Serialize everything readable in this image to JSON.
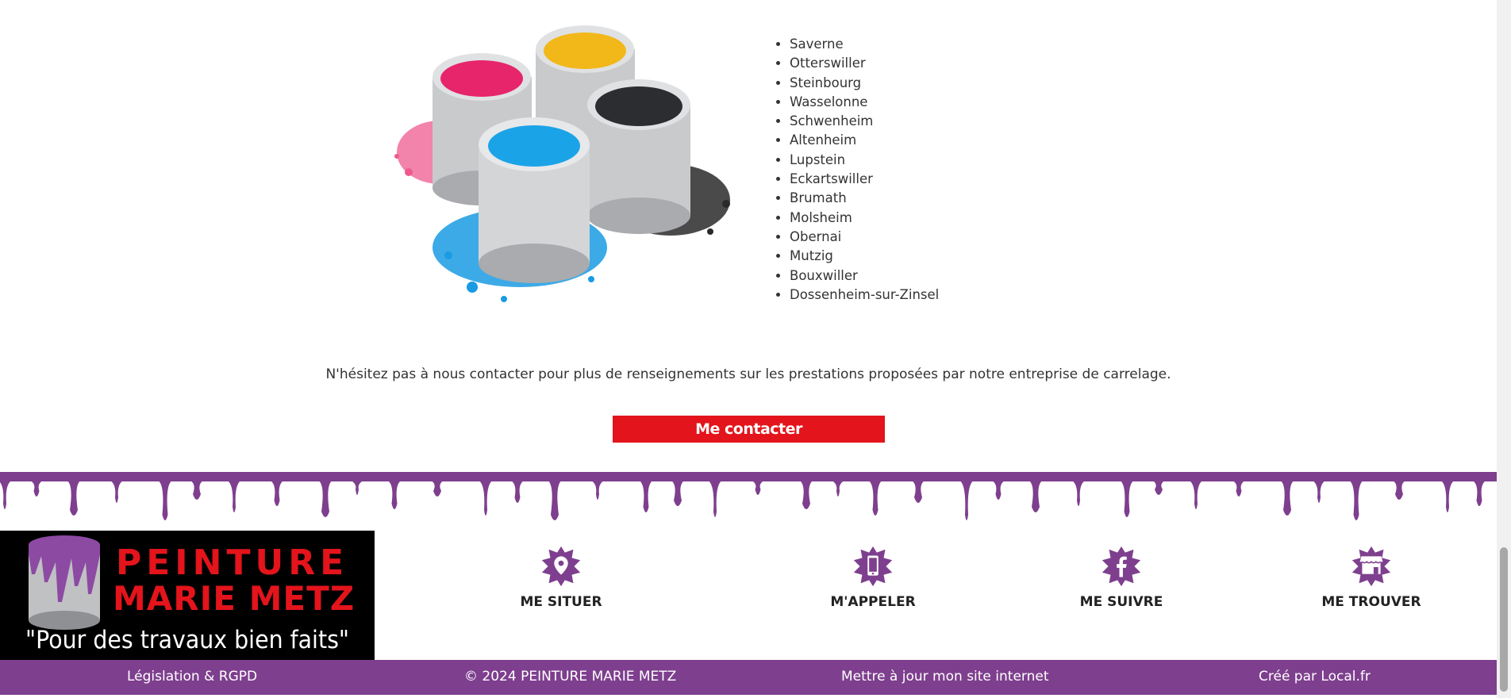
{
  "cities": [
    "Saverne",
    "Otterswiller",
    "Steinbourg",
    "Wasselonne",
    "Schwenheim",
    "Altenheim",
    "Lupstein",
    "Eckartswiller",
    "Brumath",
    "Molsheim",
    "Obernai",
    "Mutzig",
    "Bouxwiller",
    "Dossenheim-sur-Zinsel"
  ],
  "cta": {
    "text": "N'hésitez pas à nous contacter pour plus de renseignements sur les prestations proposées par notre entreprise de carrelage.",
    "button": "Me contacter"
  },
  "logo": {
    "line1": "PEINTURE",
    "line2": "MARIE METZ",
    "tagline": "\"Pour des travaux bien faits\""
  },
  "actions": [
    {
      "label": "ME SITUER",
      "icon": "map-pin-icon"
    },
    {
      "label": "M'APPELER",
      "icon": "phone-icon"
    },
    {
      "label": "ME SUIVRE",
      "icon": "facebook-icon"
    },
    {
      "label": "ME TROUVER",
      "icon": "storefront-icon"
    }
  ],
  "footer_links": {
    "legal": "Législation & RGPD",
    "copyright": "© 2024 PEINTURE MARIE METZ",
    "update": "Mettre à jour mon site internet",
    "created": "Créé par Local.fr"
  },
  "colors": {
    "accent": "#7e3f8e",
    "button": "#e3141b",
    "logo_red": "#e3141b"
  }
}
